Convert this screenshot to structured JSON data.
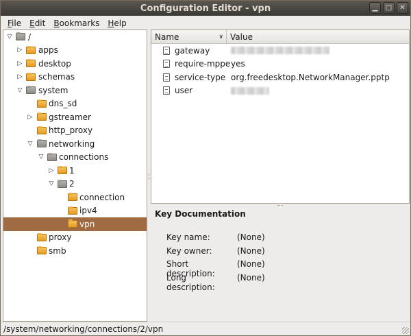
{
  "window": {
    "title": "Configuration Editor - vpn"
  },
  "menubar": {
    "items": [
      {
        "mnemonic": "F",
        "rest": "ile"
      },
      {
        "mnemonic": "E",
        "rest": "dit"
      },
      {
        "mnemonic": "B",
        "rest": "ookmarks"
      },
      {
        "mnemonic": "H",
        "rest": "elp"
      }
    ]
  },
  "tree": {
    "items": [
      {
        "label": "/"
      },
      {
        "label": "apps"
      },
      {
        "label": "desktop"
      },
      {
        "label": "schemas"
      },
      {
        "label": "system"
      },
      {
        "label": "dns_sd"
      },
      {
        "label": "gstreamer"
      },
      {
        "label": "http_proxy"
      },
      {
        "label": "networking"
      },
      {
        "label": "connections"
      },
      {
        "label": "1"
      },
      {
        "label": "2"
      },
      {
        "label": "connection"
      },
      {
        "label": "ipv4"
      },
      {
        "label": "vpn"
      },
      {
        "label": "proxy"
      },
      {
        "label": "smb"
      }
    ]
  },
  "list": {
    "columns": {
      "name": "Name",
      "value": "Value"
    },
    "rows": [
      {
        "name": "gateway",
        "value": ""
      },
      {
        "name": "require-mppe",
        "value": "yes"
      },
      {
        "name": "service-type",
        "value": "org.freedesktop.NetworkManager.pptp"
      },
      {
        "name": "user",
        "value": ""
      }
    ]
  },
  "documentation": {
    "title": "Key Documentation",
    "key_name_label": "Key name:",
    "key_name_value": "(None)",
    "key_owner_label": "Key owner:",
    "key_owner_value": "(None)",
    "short_desc_label": "Short description:",
    "short_desc_value": "(None)",
    "long_desc_label": "Long description:",
    "long_desc_value": "(None)"
  },
  "statusbar": {
    "path": "/system/networking/connections/2/vpn"
  }
}
